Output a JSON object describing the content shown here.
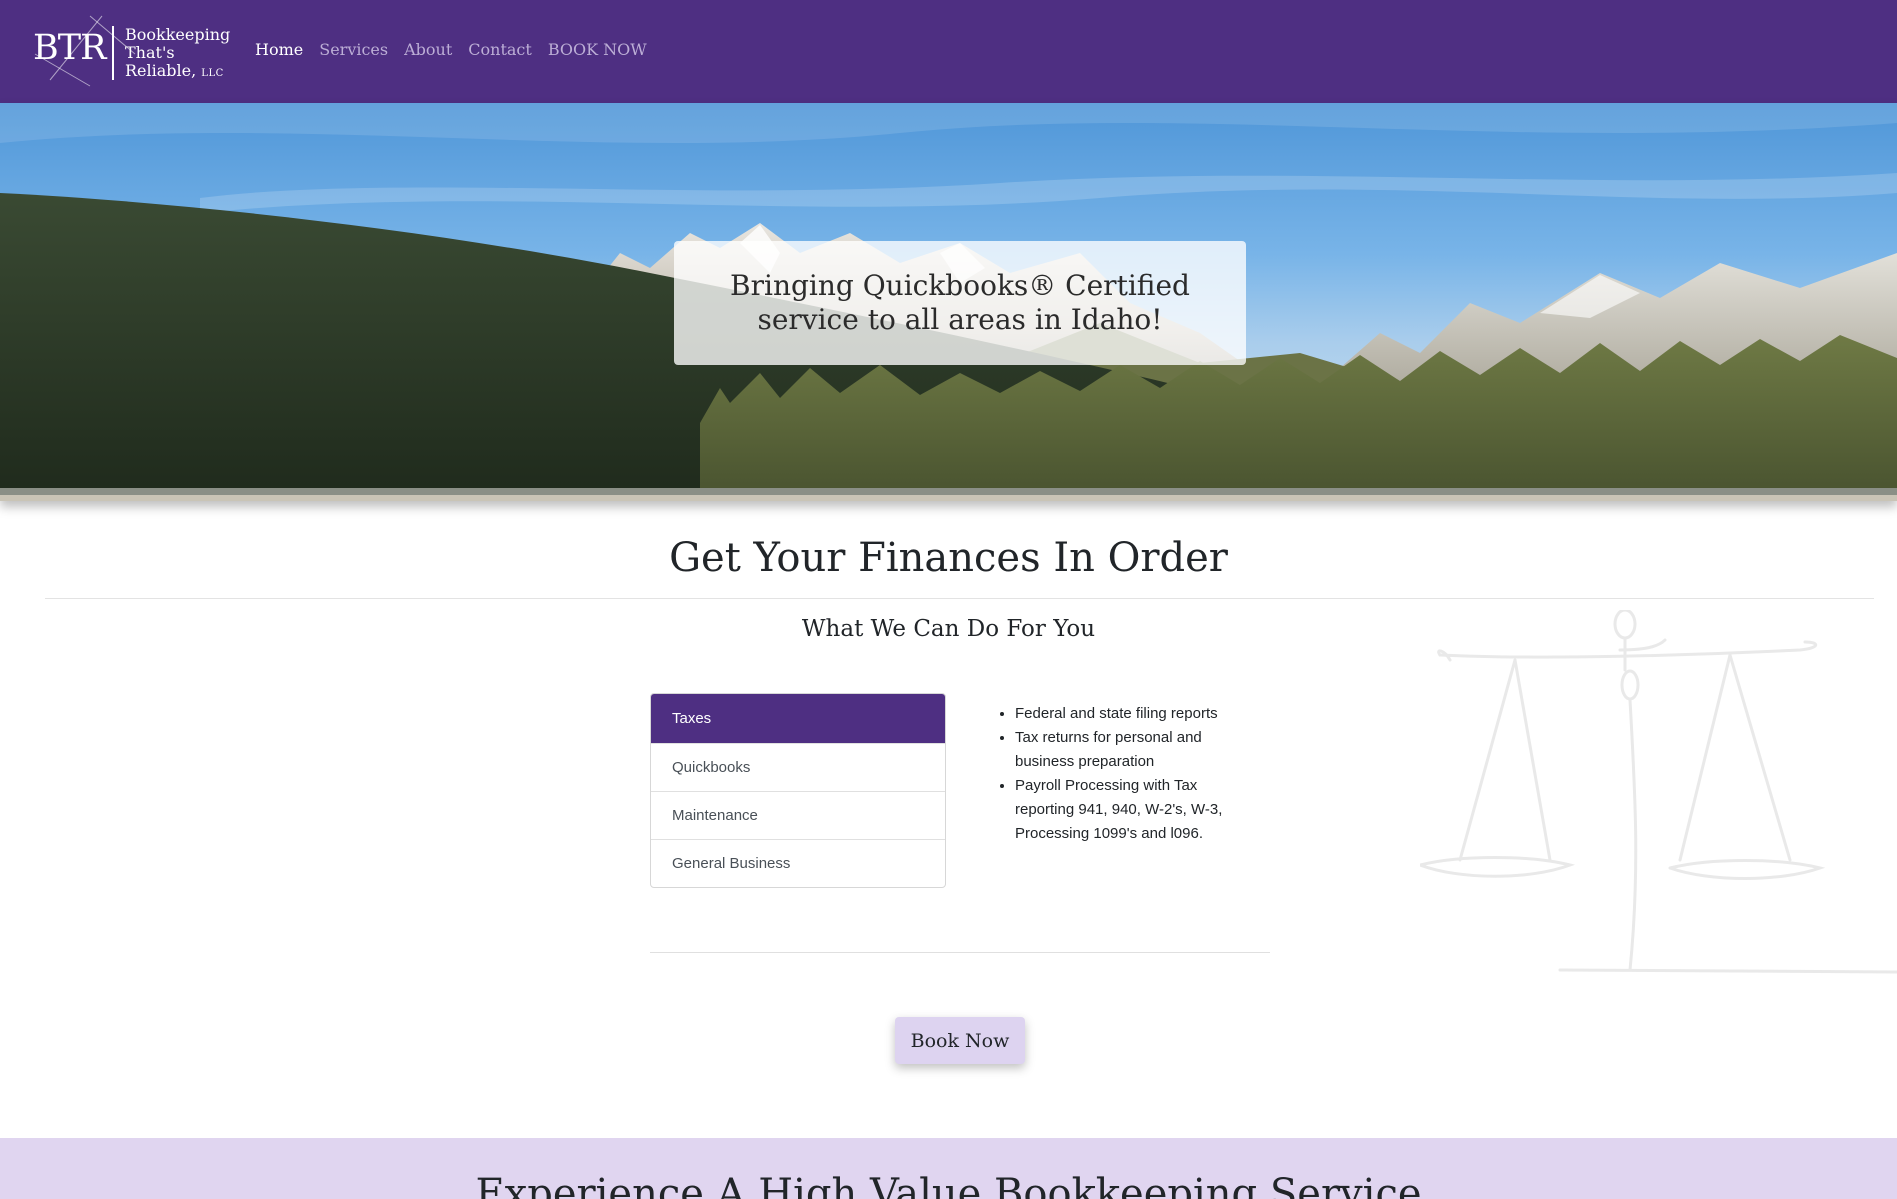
{
  "nav": {
    "logo": {
      "mark": "BTR",
      "line1": "Bookkeeping",
      "line2": "That's",
      "line3": "Reliable,",
      "suffix": "LLC"
    },
    "links": [
      {
        "label": "Home",
        "active": true
      },
      {
        "label": "Services",
        "active": false
      },
      {
        "label": "About",
        "active": false
      },
      {
        "label": "Contact",
        "active": false
      },
      {
        "label": "BOOK NOW",
        "active": false
      }
    ]
  },
  "hero": {
    "tagline": "Bringing Quickbooks® Certified service to all areas in Idaho!"
  },
  "main": {
    "title": "Get Your Finances In Order",
    "subtitle": "What We Can Do For You",
    "tabs": [
      {
        "label": "Taxes",
        "active": true
      },
      {
        "label": "Quickbooks",
        "active": false
      },
      {
        "label": "Maintenance",
        "active": false
      },
      {
        "label": "General Business",
        "active": false
      }
    ],
    "active_tab_items": [
      "Federal and state filing reports",
      "Tax returns for personal and business preparation",
      "Payroll Processing with Tax reporting 941, 940, W-2's, W-3, Processing 1099's and l096."
    ],
    "book_button": "Book Now"
  },
  "band": {
    "title": "Experience A High Value Bookkeeping Service"
  },
  "colors": {
    "brand_purple": "#4e2f82",
    "light_purple": "#ddd3f0",
    "band_purple": "#e0d5f0",
    "nav_inactive": "#bcaed6"
  }
}
